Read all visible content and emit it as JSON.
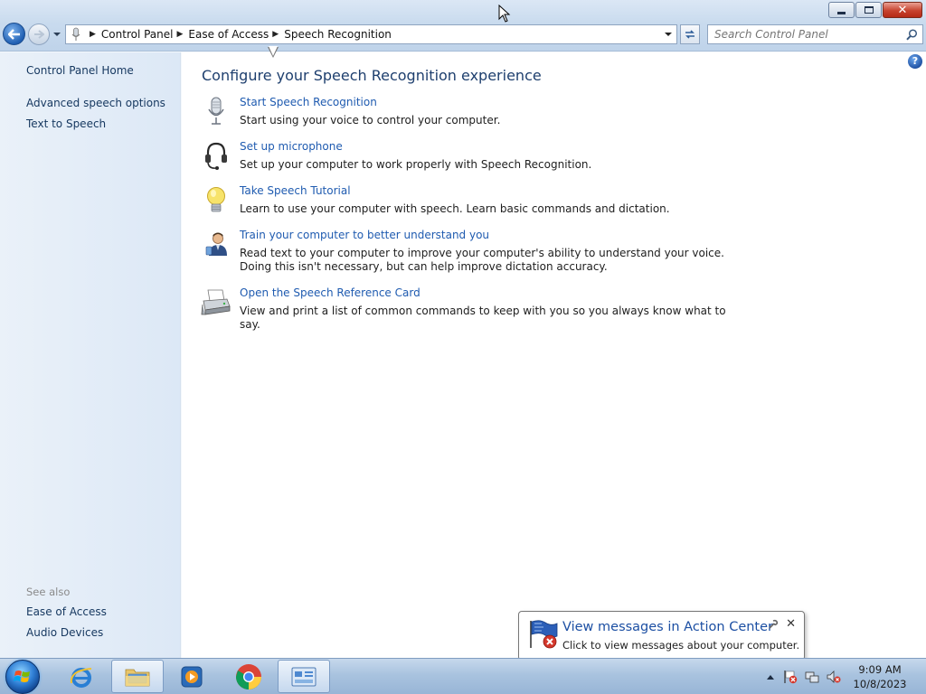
{
  "window": {
    "caption": {
      "minimize": "minimize",
      "maximize": "restore",
      "close": "close"
    }
  },
  "address": {
    "crumbs": [
      "Control Panel",
      "Ease of Access",
      "Speech Recognition"
    ]
  },
  "search": {
    "placeholder": "Search Control Panel"
  },
  "sidebar": {
    "home": "Control Panel Home",
    "items": [
      "Advanced speech options",
      "Text to Speech"
    ],
    "see_also_label": "See also",
    "see_also": [
      "Ease of Access",
      "Audio Devices"
    ]
  },
  "main": {
    "title": "Configure your Speech Recognition experience",
    "tasks": [
      {
        "link": "Start Speech Recognition",
        "desc": "Start using your voice to control your computer.",
        "icon": "microphone-icon"
      },
      {
        "link": "Set up microphone",
        "desc": "Set up your computer to work properly with Speech Recognition.",
        "icon": "headset-icon"
      },
      {
        "link": "Take Speech Tutorial",
        "desc": "Learn to use your computer with speech.  Learn basic commands and dictation.",
        "icon": "lightbulb-icon"
      },
      {
        "link": "Train your computer to better understand you",
        "desc": "Read text to your computer to improve your computer's ability to understand your voice.  Doing this isn't necessary, but can help improve dictation accuracy.",
        "icon": "user-icon"
      },
      {
        "link": "Open the Speech Reference Card",
        "desc": "View and print a list of common commands to keep with you so you always know what to say.",
        "icon": "printer-icon"
      }
    ]
  },
  "balloon": {
    "title": "View messages in Action Center",
    "text": "Click to view messages about your computer."
  },
  "taskbar": {
    "time": "9:09 AM",
    "date": "10/8/2023",
    "apps": [
      "internet-explorer",
      "windows-explorer",
      "media-player",
      "chrome",
      "control-panel"
    ]
  },
  "colors": {
    "link": "#1f5bb0",
    "title": "#1e3f6e",
    "sidebar_link": "#15375f"
  }
}
